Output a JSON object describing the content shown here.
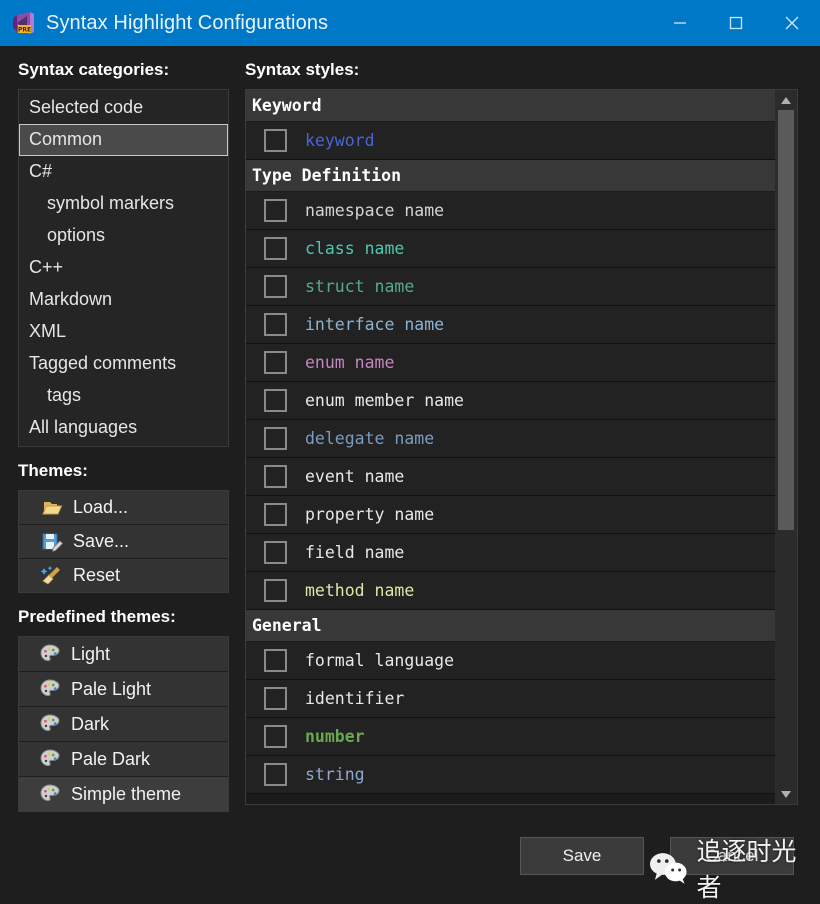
{
  "window": {
    "title": "Syntax Highlight Configurations",
    "icon": "visual-studio-pre-icon",
    "titlebar_color": "#0078c8",
    "minimize_label": "—",
    "maximize_label": "□",
    "close_label": "✕"
  },
  "left": {
    "categories_label": "Syntax categories:",
    "categories": [
      {
        "label": "Selected code",
        "indent": false,
        "selected": false
      },
      {
        "label": "Common",
        "indent": false,
        "selected": true
      },
      {
        "label": "C#",
        "indent": false,
        "selected": false
      },
      {
        "label": "symbol markers",
        "indent": true,
        "selected": false
      },
      {
        "label": "options",
        "indent": true,
        "selected": false
      },
      {
        "label": "C++",
        "indent": false,
        "selected": false
      },
      {
        "label": "Markdown",
        "indent": false,
        "selected": false
      },
      {
        "label": "XML",
        "indent": false,
        "selected": false
      },
      {
        "label": "Tagged comments",
        "indent": false,
        "selected": false
      },
      {
        "label": "tags",
        "indent": true,
        "selected": false
      },
      {
        "label": "All languages",
        "indent": false,
        "selected": false
      }
    ],
    "themes_label": "Themes:",
    "theme_buttons": [
      {
        "label": "Load...",
        "icon": "open-folder-icon"
      },
      {
        "label": "Save...",
        "icon": "floppy-disk-pencil-icon"
      },
      {
        "label": "Reset",
        "icon": "broom-sparkle-icon"
      }
    ],
    "predefined_label": "Predefined themes:",
    "predefined_themes": [
      {
        "label": "Light",
        "icon": "palette-icon"
      },
      {
        "label": "Pale Light",
        "icon": "palette-icon"
      },
      {
        "label": "Dark",
        "icon": "palette-icon"
      },
      {
        "label": "Pale Dark",
        "icon": "palette-icon"
      },
      {
        "label": "Simple theme",
        "icon": "palette-icon"
      }
    ]
  },
  "right": {
    "styles_label": "Syntax styles:",
    "groups": [
      {
        "header": "Keyword",
        "items": [
          {
            "label": "keyword",
            "color": "#4a64d8",
            "bold": false,
            "checked": false
          }
        ]
      },
      {
        "header": "Type Definition",
        "items": [
          {
            "label": "namespace name",
            "color": "#d4d4d4",
            "bold": false,
            "checked": false
          },
          {
            "label": "class name",
            "color": "#4ec9b0",
            "bold": false,
            "checked": false
          },
          {
            "label": "struct name",
            "color": "#57a893",
            "bold": false,
            "checked": false
          },
          {
            "label": "interface name",
            "color": "#8cb4d2",
            "bold": false,
            "checked": false
          },
          {
            "label": "enum name",
            "color": "#c586c0",
            "bold": false,
            "checked": false
          },
          {
            "label": "enum member name",
            "color": "#e8e8e8",
            "bold": false,
            "checked": false
          },
          {
            "label": "delegate name",
            "color": "#7a9cc0",
            "bold": false,
            "checked": false
          },
          {
            "label": "event name",
            "color": "#e8e8e8",
            "bold": false,
            "checked": false
          },
          {
            "label": "property name",
            "color": "#e8e8e8",
            "bold": false,
            "checked": false
          },
          {
            "label": "field name",
            "color": "#e8e8e8",
            "bold": false,
            "checked": false
          },
          {
            "label": "method name",
            "color": "#e4e4a8",
            "bold": false,
            "checked": false
          }
        ]
      },
      {
        "header": "General",
        "items": [
          {
            "label": "formal language",
            "color": "#e8e8e8",
            "bold": false,
            "checked": false
          },
          {
            "label": "identifier",
            "color": "#e8e8e8",
            "bold": false,
            "checked": false
          },
          {
            "label": "number",
            "color": "#6aa84f",
            "bold": true,
            "checked": false
          },
          {
            "label": "string",
            "color": "#8fa8c8",
            "bold": false,
            "checked": false
          }
        ]
      }
    ],
    "scrollbar": {
      "up_arrow": "scroll-up-arrow",
      "down_arrow": "scroll-down-arrow"
    }
  },
  "footer": {
    "save_label": "Save",
    "cancel_label": "Cancel"
  },
  "watermark": {
    "text": "追逐时光者",
    "icon": "wechat-icon"
  }
}
